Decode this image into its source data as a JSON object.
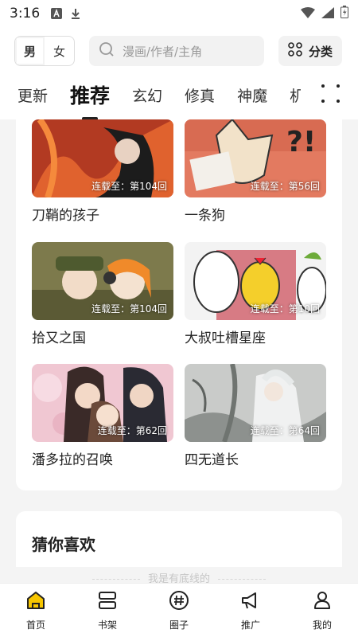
{
  "status_bar": {
    "time": "3:16"
  },
  "top_bar": {
    "gender_options": [
      "男",
      "女"
    ],
    "search_placeholder": "漫画/作者/主角",
    "category_label": "分类"
  },
  "tabs": [
    "更新",
    "推荐",
    "玄幻",
    "修真",
    "神魔",
    "机"
  ],
  "active_tab": "推荐",
  "comics": [
    {
      "title": "刀鞘的孩子",
      "badge": "连载至：第104回"
    },
    {
      "title": "一条狗",
      "badge": "连载至：第56回"
    },
    {
      "title": "拾又之国",
      "badge": "连载至：第104回"
    },
    {
      "title": "大叔吐槽星座",
      "badge": "连载至：第10回"
    },
    {
      "title": "潘多拉的召唤",
      "badge": "连载至：第62回"
    },
    {
      "title": "四无道长",
      "badge": "连载至：第64回"
    }
  ],
  "guess_section": {
    "title": "猜你喜欢"
  },
  "footer_note": "我是有底线的",
  "bottom_nav": [
    {
      "label": "首页",
      "icon": "home-icon",
      "active": true
    },
    {
      "label": "书架",
      "icon": "bookshelf-icon",
      "active": false
    },
    {
      "label": "圈子",
      "icon": "hashtag-icon",
      "active": false
    },
    {
      "label": "推广",
      "icon": "megaphone-icon",
      "active": false
    },
    {
      "label": "我的",
      "icon": "user-icon",
      "active": false
    }
  ],
  "colors": {
    "accent": "#f7c600",
    "panel_bg": "#f4f4f4",
    "text": "#222222"
  }
}
